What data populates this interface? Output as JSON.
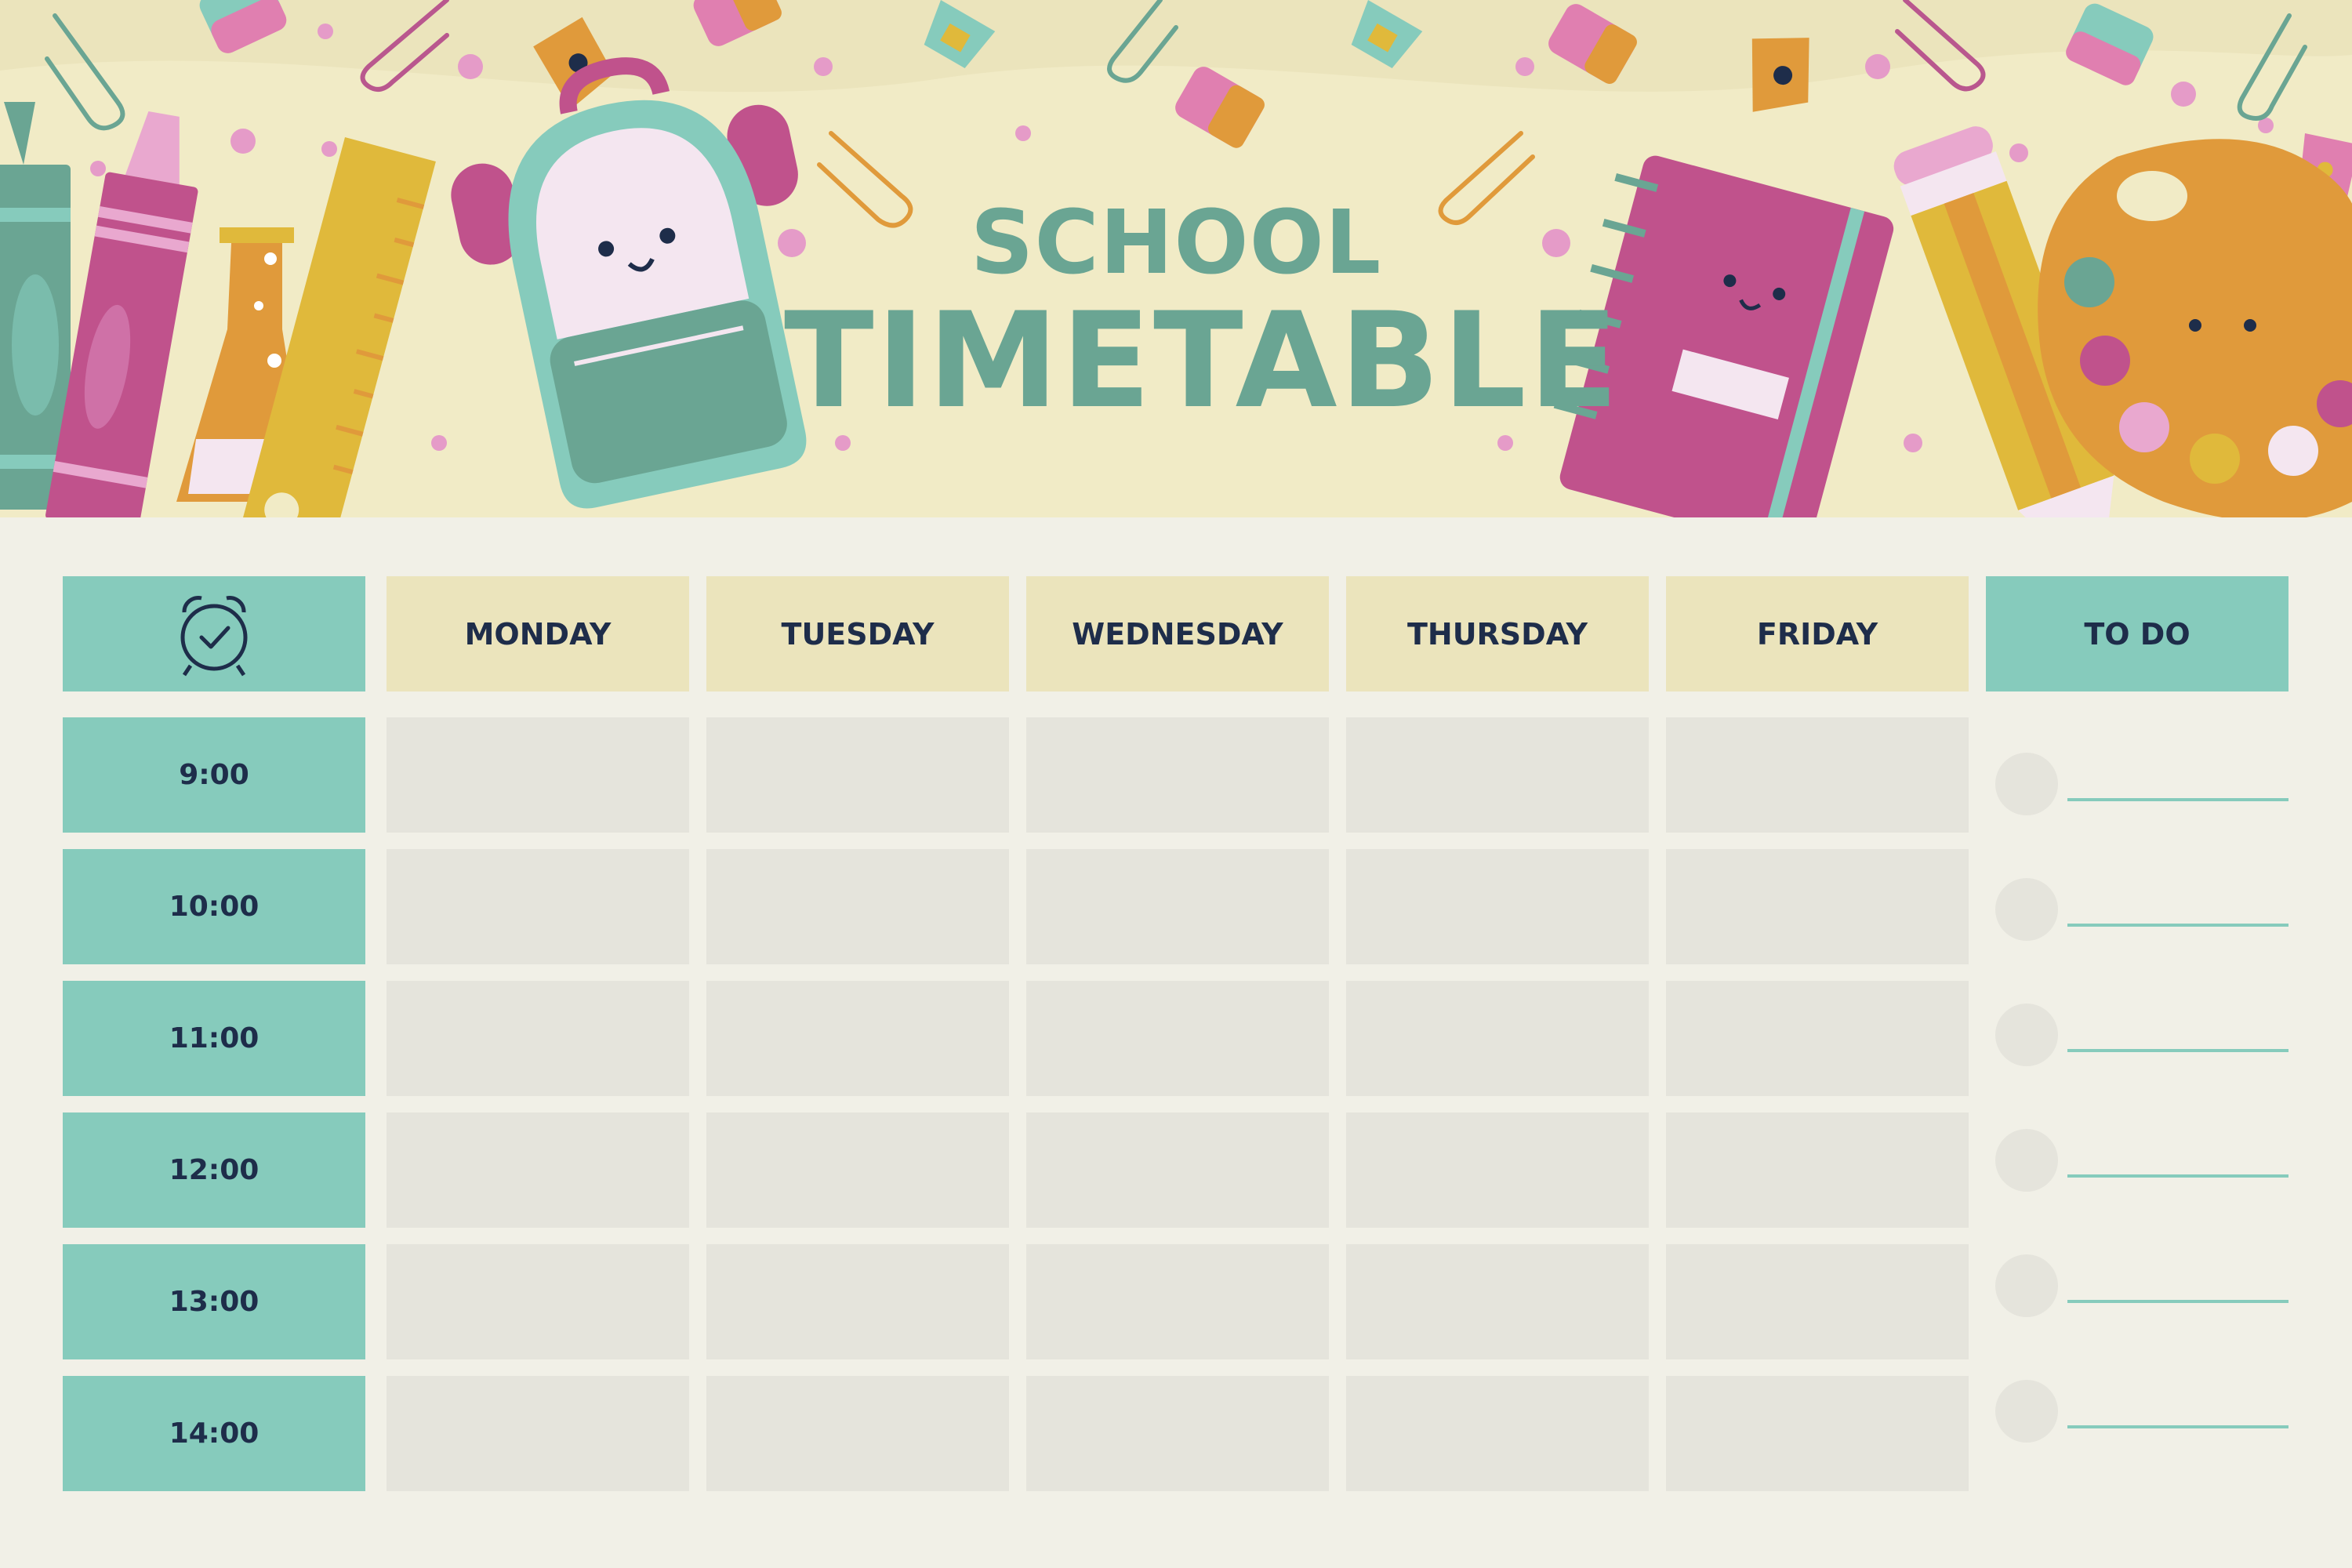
{
  "title": {
    "line1": "SCHOOL",
    "line2": "TIMETABLE"
  },
  "header_icon": "alarm-clock-icon",
  "days": [
    "MONDAY",
    "TUESDAY",
    "WEDNESDAY",
    "THURSDAY",
    "FRIDAY"
  ],
  "todo_label": "TO DO",
  "times": [
    "9:00",
    "10:00",
    "11:00",
    "12:00",
    "13:00",
    "14:00"
  ],
  "colors": {
    "teal": "#86cbbc",
    "title_teal": "#6aa593",
    "day_header": "#ebe4bc",
    "slot": "#e5e4dc",
    "page": "#f1f0e7",
    "header_band": "#f1ebc6",
    "text_dark": "#1e2d4a"
  },
  "illustrations": [
    "crayon-teal-icon",
    "crayon-pink-icon",
    "flask-icon",
    "ruler-icon",
    "backpack-icon",
    "notebook-icon",
    "pencil-icon",
    "paint-palette-icon",
    "eraser-icon",
    "paperclip-icon",
    "pencil-sharpener-icon"
  ]
}
